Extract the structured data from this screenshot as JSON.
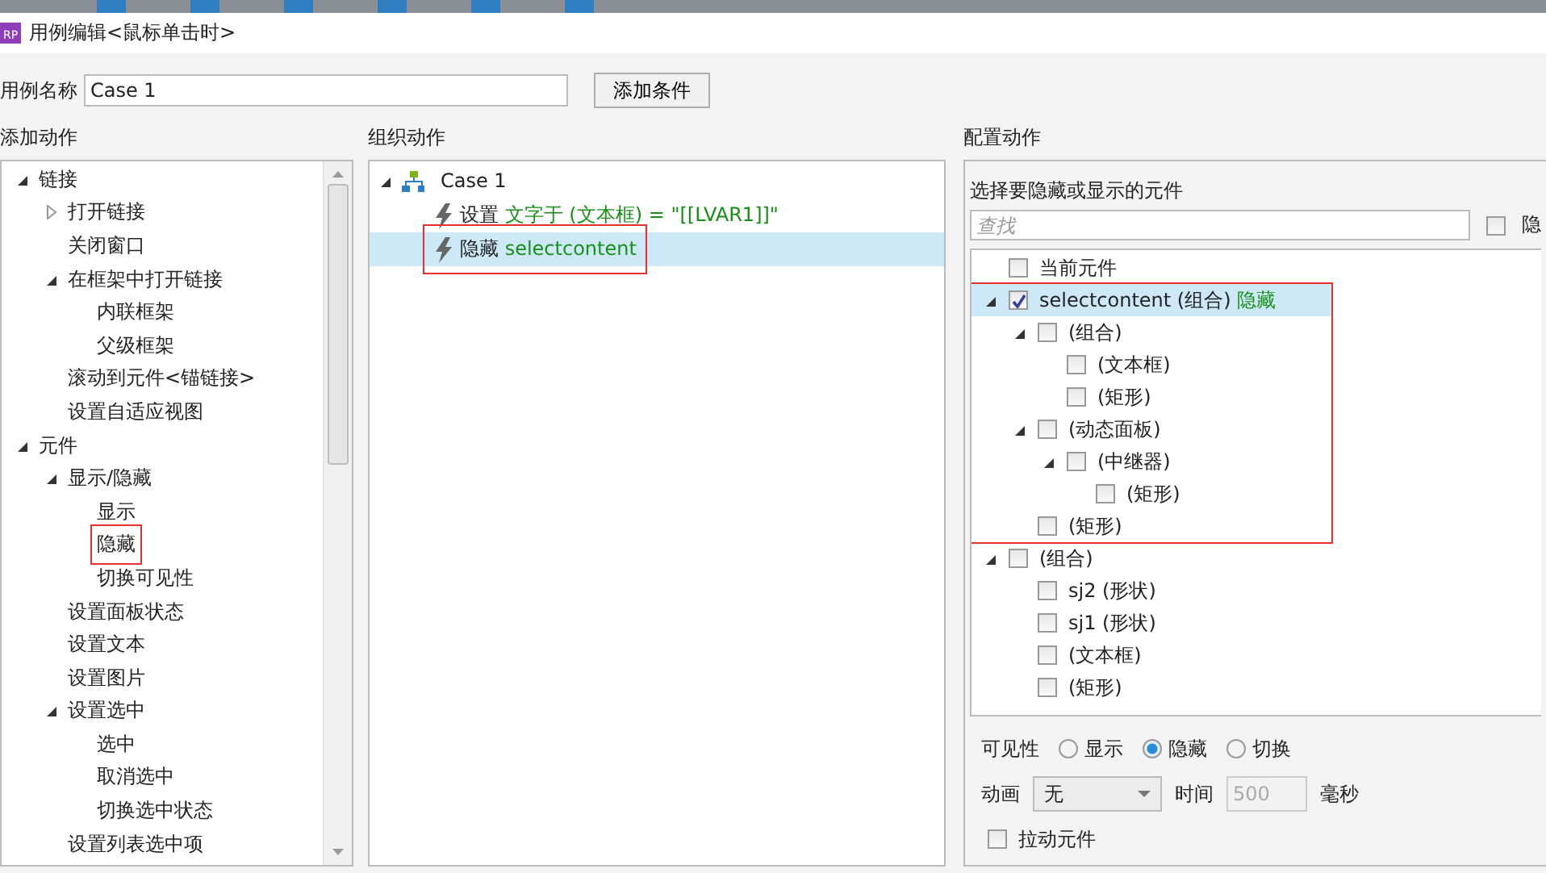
{
  "window": {
    "app_badge": "RP",
    "title": "用例编辑<鼠标单击时>"
  },
  "case_name": {
    "label": "用例名称",
    "value": "Case 1"
  },
  "add_condition_button": "添加条件",
  "add_actions": {
    "heading": "添加动作",
    "tree": [
      {
        "label": "链接",
        "expanded": true,
        "highlighted": false,
        "children": [
          {
            "label": "打开链接",
            "expanded": false,
            "highlighted": false
          },
          {
            "label": "关闭窗口",
            "highlighted": false
          },
          {
            "label": "在框架中打开链接",
            "expanded": true,
            "highlighted": false,
            "children": [
              {
                "label": "内联框架",
                "highlighted": false
              },
              {
                "label": "父级框架",
                "highlighted": false
              }
            ]
          },
          {
            "label": "滚动到元件<锚链接>",
            "highlighted": false
          },
          {
            "label": "设置自适应视图",
            "highlighted": false
          }
        ]
      },
      {
        "label": "元件",
        "expanded": true,
        "highlighted": false,
        "children": [
          {
            "label": "显示/隐藏",
            "expanded": true,
            "highlighted": false,
            "children": [
              {
                "label": "显示",
                "highlighted": false
              },
              {
                "label": "隐藏",
                "highlighted": true
              },
              {
                "label": "切换可见性",
                "highlighted": false
              }
            ]
          },
          {
            "label": "设置面板状态",
            "highlighted": false
          },
          {
            "label": "设置文本",
            "highlighted": false
          },
          {
            "label": "设置图片",
            "highlighted": false
          },
          {
            "label": "设置选中",
            "expanded": true,
            "highlighted": false,
            "children": [
              {
                "label": "选中",
                "highlighted": false
              },
              {
                "label": "取消选中",
                "highlighted": false
              },
              {
                "label": "切换选中状态",
                "highlighted": false
              }
            ]
          },
          {
            "label": "设置列表选中项",
            "highlighted": false
          }
        ]
      }
    ]
  },
  "organize_actions": {
    "heading": "组织动作",
    "case": {
      "label": "Case 1",
      "expanded": true
    },
    "actions": [
      {
        "verb": "设置",
        "target": "文字于 (文本框) = \"[[LVAR1]]\"",
        "selected": false,
        "highlighted": false
      },
      {
        "verb": "隐藏",
        "target": "selectcontent",
        "selected": true,
        "highlighted": true
      }
    ]
  },
  "configure_action": {
    "heading": "配置动作",
    "prompt": "选择要隐藏或显示的元件",
    "search": {
      "placeholder": "查找"
    },
    "hide_unplaced": {
      "label": "隐",
      "checked": false
    },
    "widgets": [
      {
        "label": "当前元件",
        "checked": false,
        "selected": false,
        "highlighted": false
      },
      {
        "label": "selectcontent (组合)",
        "status": "隐藏",
        "checked": true,
        "selected": true,
        "expanded": true,
        "highlighted": true,
        "children": [
          {
            "label": "(组合)",
            "checked": false,
            "selected": false,
            "expanded": true,
            "highlighted": false,
            "children": [
              {
                "label": "(文本框)",
                "checked": false,
                "selected": false,
                "highlighted": false
              },
              {
                "label": "(矩形)",
                "checked": false,
                "selected": false,
                "highlighted": false
              }
            ]
          },
          {
            "label": "(动态面板)",
            "checked": false,
            "selected": false,
            "expanded": true,
            "highlighted": false,
            "children": [
              {
                "label": "(中继器)",
                "checked": false,
                "selected": false,
                "expanded": true,
                "highlighted": false,
                "children": [
                  {
                    "label": "(矩形)",
                    "checked": false,
                    "selected": false,
                    "highlighted": false
                  }
                ]
              }
            ]
          },
          {
            "label": "(矩形)",
            "checked": false,
            "selected": false,
            "highlighted": false
          }
        ]
      },
      {
        "label": "(组合)",
        "checked": false,
        "selected": false,
        "expanded": true,
        "highlighted": false,
        "children": [
          {
            "label": "sj2 (形状)",
            "checked": false,
            "selected": false,
            "highlighted": false
          },
          {
            "label": "sj1 (形状)",
            "checked": false,
            "selected": false,
            "highlighted": false
          },
          {
            "label": "(文本框)",
            "checked": false,
            "selected": false,
            "highlighted": false
          },
          {
            "label": "(矩形)",
            "checked": false,
            "selected": false,
            "highlighted": false
          }
        ]
      }
    ],
    "visibility": {
      "label": "可见性",
      "options": [
        {
          "label": "显示",
          "selected": false
        },
        {
          "label": "隐藏",
          "selected": true
        },
        {
          "label": "切换",
          "selected": false
        }
      ]
    },
    "animation": {
      "label": "动画",
      "value": "无",
      "time_label": "时间",
      "time_value": "500",
      "unit": "毫秒"
    },
    "drag_widget": {
      "label": "拉动元件",
      "checked": false
    }
  }
}
